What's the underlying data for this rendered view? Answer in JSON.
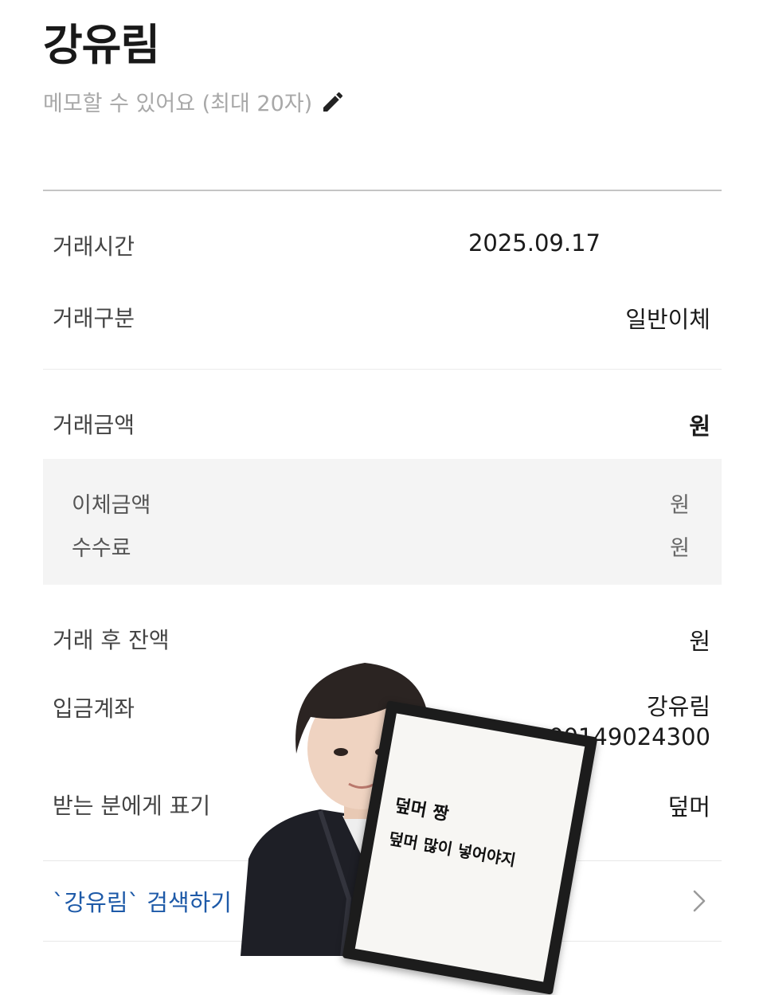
{
  "header": {
    "name": "강유림",
    "memo_placeholder": "메모할 수 있어요 (최대 20자)"
  },
  "details": {
    "time_label": "거래시간",
    "time_value": "2025.09.17",
    "type_label": "거래구분",
    "type_value": "일반이체",
    "amount_label": "거래금액",
    "amount_value": "원",
    "transfer_label": "이체금액",
    "transfer_value": "원",
    "fee_label": "수수료",
    "fee_value": "원",
    "balance_label": "거래 후 잔액",
    "balance_value": "원",
    "account_label": "입금계좌",
    "account_name": "강유림",
    "account_number": "토스뱅크 100149024300",
    "display_label": "받는 분에게 표기",
    "display_value": "덮머"
  },
  "search_link": "`강유림` 검색하기",
  "sign": {
    "line1": "덮머 짱",
    "line2": "덮머 많이 넣어야지"
  },
  "colors": {
    "link": "#1e5aa8",
    "muted": "#a8a8a8",
    "sub_box": "#f4f4f4"
  },
  "icons": [
    "pencil-icon",
    "chevron-right-icon"
  ]
}
